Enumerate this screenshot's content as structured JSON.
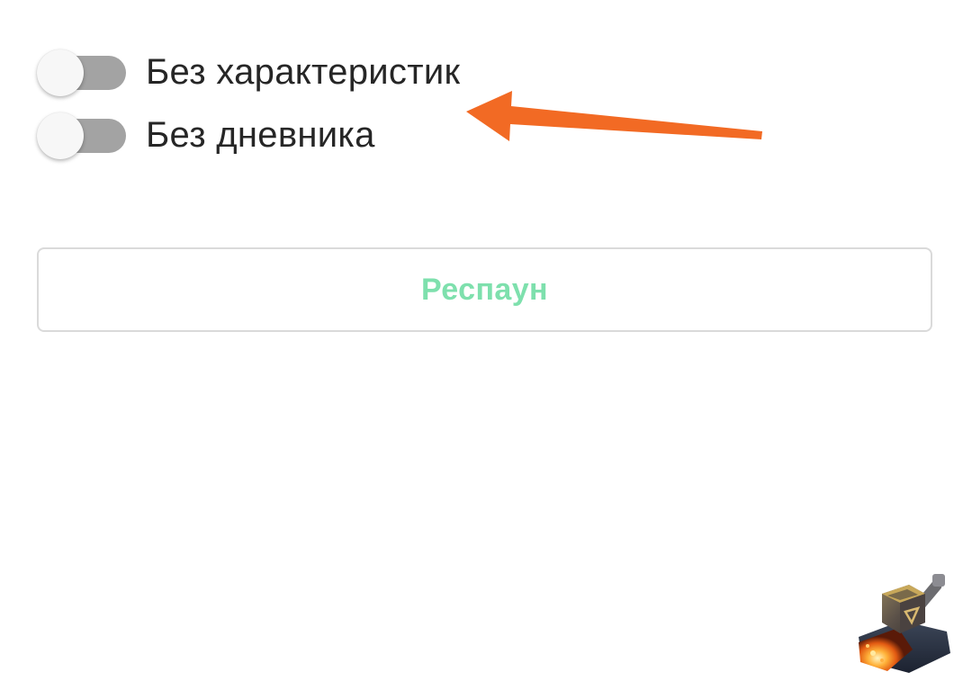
{
  "settings": {
    "toggles": [
      {
        "label": "Без характеристик",
        "enabled": false
      },
      {
        "label": "Без дневника",
        "enabled": false
      }
    ],
    "respawn_label": "Респаун"
  },
  "colors": {
    "toggle_track_off": "#a3a3a3",
    "toggle_thumb": "#f7f7f7",
    "button_text": "#7ee0ad",
    "button_border": "#dadada",
    "annotation_arrow": "#f26a24"
  },
  "icons": {
    "annotation": "orange-arrow-icon",
    "app_badge": "anvil-forge-icon"
  }
}
